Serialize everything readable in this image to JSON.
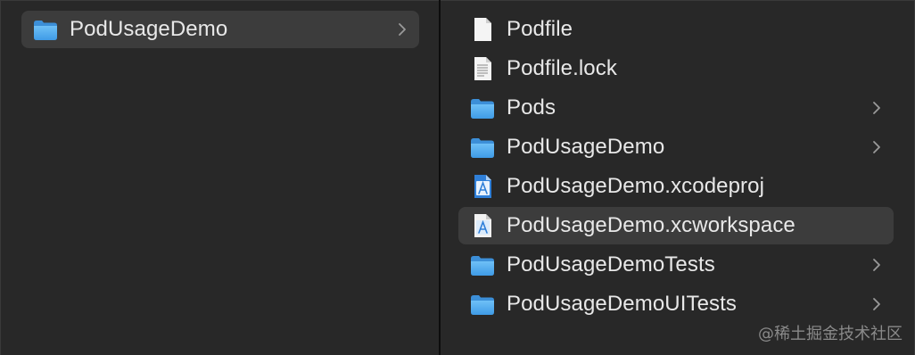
{
  "left_column": {
    "items": [
      {
        "label": "PodUsageDemo",
        "icon": "folder-icon",
        "has_children": true,
        "selected": true
      }
    ]
  },
  "right_column": {
    "items": [
      {
        "label": "Podfile",
        "icon": "blank-document-icon",
        "has_children": false,
        "selected": false
      },
      {
        "label": "Podfile.lock",
        "icon": "text-document-icon",
        "has_children": false,
        "selected": false
      },
      {
        "label": "Pods",
        "icon": "folder-icon",
        "has_children": true,
        "selected": false
      },
      {
        "label": "PodUsageDemo",
        "icon": "folder-icon",
        "has_children": true,
        "selected": false
      },
      {
        "label": "PodUsageDemo.xcodeproj",
        "icon": "xcode-project-icon",
        "has_children": false,
        "selected": false
      },
      {
        "label": "PodUsageDemo.xcworkspace",
        "icon": "xcode-workspace-icon",
        "has_children": false,
        "selected": true
      },
      {
        "label": "PodUsageDemoTests",
        "icon": "folder-icon",
        "has_children": true,
        "selected": false
      },
      {
        "label": "PodUsageDemoUITests",
        "icon": "folder-icon",
        "has_children": true,
        "selected": false
      }
    ]
  },
  "watermark": "@稀土掘金技术社区",
  "colors": {
    "background": "#282828",
    "selection": "#3c3c3c",
    "folder": "#5aaef0",
    "text": "#e8e8e8"
  }
}
